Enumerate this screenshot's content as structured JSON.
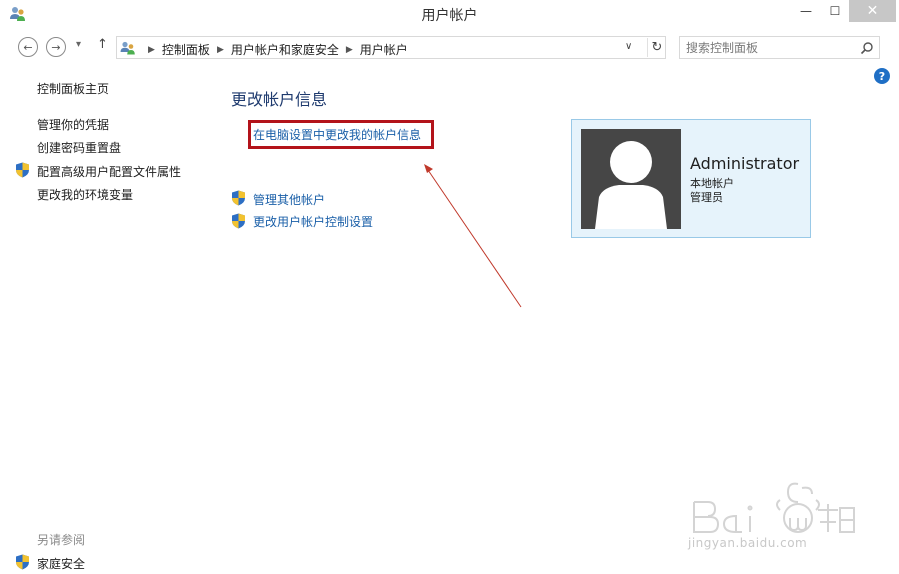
{
  "window": {
    "title": "用户帐户",
    "minimize": "—",
    "maximize": "☐",
    "close": "✕"
  },
  "navigation": {
    "back_icon": "←",
    "forward_icon": "→",
    "recent_icon": "▾",
    "up_icon": "↑",
    "breadcrumbs": [
      "控制面板",
      "用户帐户和家庭安全",
      "用户帐户"
    ],
    "separator": "▶",
    "dropdown_icon": "∨",
    "refresh_icon": "↻",
    "search_placeholder": "搜索控制面板"
  },
  "help_icon": "?",
  "sidebar": {
    "home": "控制面板主页",
    "items": [
      "管理你的凭据",
      "创建密码重置盘",
      "配置高级用户配置文件属性",
      "更改我的环境变量"
    ],
    "see_also_title": "另请参阅",
    "see_also_items": [
      "家庭安全"
    ]
  },
  "main": {
    "heading": "更改帐户信息",
    "highlighted_link": "在电脑设置中更改我的帐户信息",
    "links": [
      "管理其他帐户",
      "更改用户帐户控制设置"
    ]
  },
  "account": {
    "name": "Administrator",
    "type": "本地帐户",
    "role": "管理员"
  },
  "watermark": {
    "url": "jingyan.baidu.com"
  },
  "colors": {
    "link": "#1a5fa8",
    "heading": "#1e3a6e",
    "highlight": "#b3131a",
    "card_bg": "#e6f3fb",
    "card_border": "#99c9e7"
  }
}
